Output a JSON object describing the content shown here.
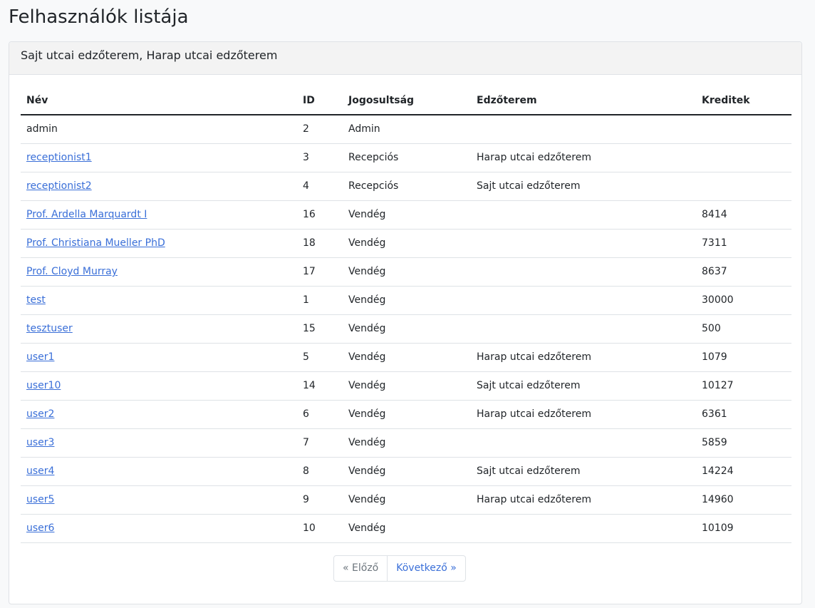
{
  "page": {
    "title": "Felhasználók listája"
  },
  "card": {
    "header": "Sajt utcai edzőterem, Harap utcai edzőterem"
  },
  "table": {
    "headers": {
      "name": "Név",
      "id": "ID",
      "role": "Jogosultság",
      "gym": "Edzőterem",
      "credits": "Kreditek"
    },
    "rows": [
      {
        "name": "admin",
        "link": false,
        "id": "2",
        "role": "Admin",
        "gym": "",
        "credits": ""
      },
      {
        "name": "receptionist1",
        "link": true,
        "id": "3",
        "role": "Recepciós",
        "gym": "Harap utcai edzőterem",
        "credits": ""
      },
      {
        "name": "receptionist2",
        "link": true,
        "id": "4",
        "role": "Recepciós",
        "gym": "Sajt utcai edzőterem",
        "credits": ""
      },
      {
        "name": "Prof. Ardella Marquardt I",
        "link": true,
        "id": "16",
        "role": "Vendég",
        "gym": "",
        "credits": "8414"
      },
      {
        "name": "Prof. Christiana Mueller PhD",
        "link": true,
        "id": "18",
        "role": "Vendég",
        "gym": "",
        "credits": "7311"
      },
      {
        "name": "Prof. Cloyd Murray",
        "link": true,
        "id": "17",
        "role": "Vendég",
        "gym": "",
        "credits": "8637"
      },
      {
        "name": "test",
        "link": true,
        "id": "1",
        "role": "Vendég",
        "gym": "",
        "credits": "30000"
      },
      {
        "name": "tesztuser",
        "link": true,
        "id": "15",
        "role": "Vendég",
        "gym": "",
        "credits": "500"
      },
      {
        "name": "user1",
        "link": true,
        "id": "5",
        "role": "Vendég",
        "gym": "Harap utcai edzőterem",
        "credits": "1079"
      },
      {
        "name": "user10",
        "link": true,
        "id": "14",
        "role": "Vendég",
        "gym": "Sajt utcai edzőterem",
        "credits": "10127"
      },
      {
        "name": "user2",
        "link": true,
        "id": "6",
        "role": "Vendég",
        "gym": "Harap utcai edzőterem",
        "credits": "6361"
      },
      {
        "name": "user3",
        "link": true,
        "id": "7",
        "role": "Vendég",
        "gym": "",
        "credits": "5859"
      },
      {
        "name": "user4",
        "link": true,
        "id": "8",
        "role": "Vendég",
        "gym": "Sajt utcai edzőterem",
        "credits": "14224"
      },
      {
        "name": "user5",
        "link": true,
        "id": "9",
        "role": "Vendég",
        "gym": "Harap utcai edzőterem",
        "credits": "14960"
      },
      {
        "name": "user6",
        "link": true,
        "id": "10",
        "role": "Vendég",
        "gym": "",
        "credits": "10109"
      }
    ]
  },
  "pagination": {
    "prev_label": "« Előző",
    "next_label": "Következő »"
  }
}
